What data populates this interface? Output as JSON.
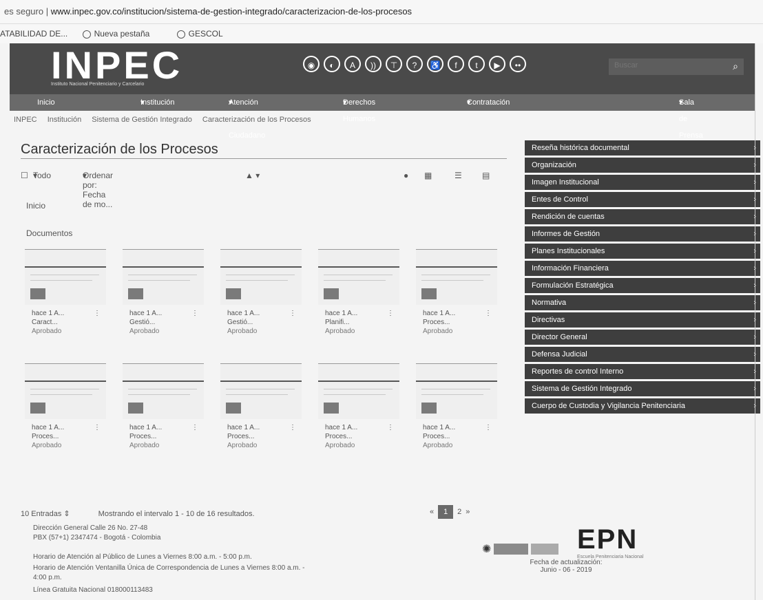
{
  "browser": {
    "secure_label": "es seguro",
    "url": "www.inpec.gov.co/institucion/sistema-de-gestion-integrado/caracterizacion-de-los-procesos",
    "bookmarks": [
      "ATABILIDAD DE...",
      "Nueva pestaña",
      "GESCOL"
    ]
  },
  "header": {
    "logo": "INPEC",
    "logo_subtitle": "Instituto Nacional Penitenciario y Carcelario",
    "social_icons": [
      "accessibility-icon",
      "contrast-icon",
      "font-size-icon",
      "rss-icon",
      "sitemap-icon",
      "help-icon",
      "accessibility-person-icon",
      "facebook-icon",
      "twitter-icon",
      "youtube-icon",
      "flickr-icon"
    ],
    "search_placeholder": "Buscar"
  },
  "nav": {
    "items": [
      "Inicio",
      "Institución",
      "Atención al Ciudadano",
      "Derechos Humanos",
      "Contratación",
      "Sala de Prensa"
    ]
  },
  "breadcrumb": [
    "INPEC",
    "Institución",
    "Sistema de Gestión Integrado",
    "Caracterización de los Procesos"
  ],
  "main": {
    "title": "Caracterización de los Procesos",
    "toolbar": {
      "filter": "Todo",
      "order": "Ordenar por: Fecha de mo...",
      "view_icons": [
        "info-icon",
        "grid-view-icon",
        "list-view-icon",
        "table-view-icon"
      ]
    },
    "section_home": "Inicio",
    "section_docs": "Documentos",
    "cards": [
      {
        "l1": "hace 1 A...",
        "l2": "Caract...",
        "l3": "Aprobado"
      },
      {
        "l1": "hace 1 A...",
        "l2": "Gestió...",
        "l3": "Aprobado"
      },
      {
        "l1": "hace 1 A...",
        "l2": "Gestió...",
        "l3": "Aprobado"
      },
      {
        "l1": "hace 1 A...",
        "l2": "Planifi...",
        "l3": "Aprobado"
      },
      {
        "l1": "hace 1 A...",
        "l2": "Proces...",
        "l3": "Aprobado"
      },
      {
        "l1": "hace 1 A...",
        "l2": "Proces...",
        "l3": "Aprobado"
      },
      {
        "l1": "hace 1 A...",
        "l2": "Proces...",
        "l3": "Aprobado"
      },
      {
        "l1": "hace 1 A...",
        "l2": "Proces...",
        "l3": "Aprobado"
      },
      {
        "l1": "hace 1 A...",
        "l2": "Proces...",
        "l3": "Aprobado"
      },
      {
        "l1": "hace 1 A...",
        "l2": "Proces...",
        "l3": "Aprobado"
      }
    ],
    "per_page": "10 Entradas",
    "results_text": "Mostrando el intervalo 1 - 10 de 16 resultados.",
    "pager": {
      "prev": "«",
      "current": "1",
      "next_page": "2",
      "next": "»"
    }
  },
  "sidebar": {
    "items": [
      "Reseña histórica documental",
      "Organización",
      "Imagen Institucional",
      "Entes de Control",
      "Rendición de cuentas",
      "Informes de Gestión",
      "Planes Institucionales",
      "Información Financiera",
      "Formulación Estratégica",
      "Normativa",
      "Directivas",
      "Director General",
      "Defensa Judicial",
      "Reportes de control Interno",
      "Sistema de Gestión Integrado",
      "Cuerpo de Custodia y Vigilancia Penitenciaria"
    ]
  },
  "footer": {
    "address1": "Dirección General Calle 26 No. 27-48",
    "address2": "PBX (57+1) 2347474 - Bogotá - Colombia",
    "hours1": "Horario de Atención al Público de Lunes a Viernes 8:00 a.m. - 5:00 p.m.",
    "hours2": "Horario de Atención Ventanilla Única de Correspondencia de Lunes a Viernes 8:00 a.m. -",
    "hours2b": "4:00 p.m.",
    "line": "Línea Gratuita Nacional 018000113483",
    "epn": "EPN",
    "epn_sub": "Escuela Penitenciaria Nacional",
    "update_label": "Fecha de actualización:",
    "update_date": "Junio - 06 - 2019"
  }
}
